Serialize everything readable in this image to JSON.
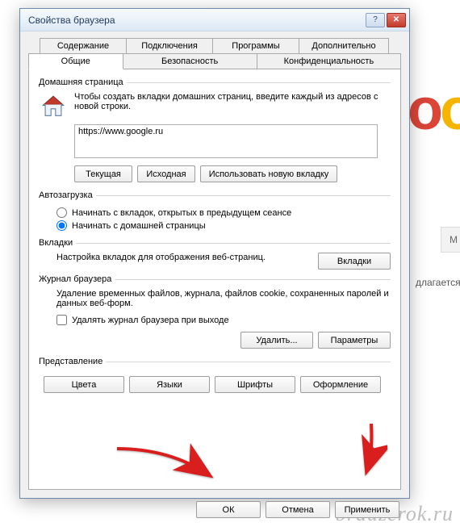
{
  "window": {
    "title": "Свойства браузера",
    "help_icon": "?",
    "close_icon": "✕"
  },
  "tabs": {
    "row1": [
      "Содержание",
      "Подключения",
      "Программы",
      "Дополнительно"
    ],
    "row2": [
      "Общие",
      "Безопасность",
      "Конфиденциальность"
    ],
    "active": "Общие"
  },
  "home": {
    "legend": "Домашняя страница",
    "desc": "Чтобы создать вкладки домашних страниц, введите каждый из адресов с новой строки.",
    "value": "https://www.google.ru",
    "btn_current": "Текущая",
    "btn_default": "Исходная",
    "btn_newtab": "Использовать новую вкладку"
  },
  "autoload": {
    "legend": "Автозагрузка",
    "opt_tabs": "Начинать с вкладок, открытых в предыдущем сеансе",
    "opt_home": "Начинать с домашней страницы",
    "selected": "home"
  },
  "tabs_section": {
    "legend": "Вкладки",
    "desc": "Настройка вкладок для отображения веб-страниц.",
    "btn": "Вкладки"
  },
  "history": {
    "legend": "Журнал браузера",
    "desc": "Удаление временных файлов, журнала, файлов cookie, сохраненных паролей и данных веб-форм.",
    "chk_onexit": "Удалять журнал браузера при выходе",
    "btn_delete": "Удалить...",
    "btn_params": "Параметры"
  },
  "appearance": {
    "legend": "Представление",
    "btn_colors": "Цвета",
    "btn_lang": "Языки",
    "btn_fonts": "Шрифты",
    "btn_style": "Оформление"
  },
  "dialog_buttons": {
    "ok": "ОК",
    "cancel": "Отмена",
    "apply": "Применить"
  },
  "background": {
    "btn_m": "М",
    "offer_text": "длагается",
    "watermark": "brauzerok.ru"
  }
}
